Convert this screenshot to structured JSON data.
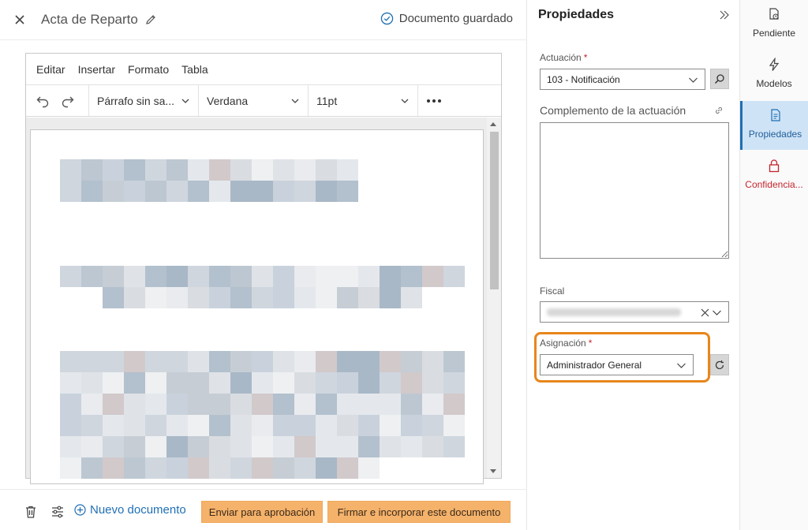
{
  "header": {
    "title": "Acta de Reparto",
    "status": "Documento guardado"
  },
  "editor": {
    "menu": [
      "Editar",
      "Insertar",
      "Formato",
      "Tabla"
    ],
    "paragraph_style": "Párrafo sin sa...",
    "font_family": "Verdana",
    "font_size": "11pt"
  },
  "footer": {
    "new_document": "Nuevo documento",
    "send_for_approval": "Enviar para aprobación",
    "sign_and_incorporate": "Firmar e incorporar este documento"
  },
  "properties": {
    "title": "Propiedades",
    "actuacion_label": "Actuación",
    "actuacion_value": "103 - Notificación",
    "complemento_label": "Complemento de la actuación",
    "complemento_value": "",
    "fiscal_label": "Fiscal",
    "asignacion_label": "Asignación",
    "asignacion_value": "Administrador General",
    "required_marker": "*"
  },
  "rail": {
    "items": [
      {
        "label": "Pendiente",
        "icon": "pending-document-icon"
      },
      {
        "label": "Modelos",
        "icon": "lightning-icon"
      },
      {
        "label": "Propiedades",
        "icon": "properties-document-icon"
      },
      {
        "label": "Confidencia...",
        "icon": "lock-icon"
      }
    ]
  },
  "colors": {
    "accent": "#1f6fb5",
    "highlight": "#e8861b",
    "button": "#f5b26b",
    "required": "#c4262e"
  }
}
